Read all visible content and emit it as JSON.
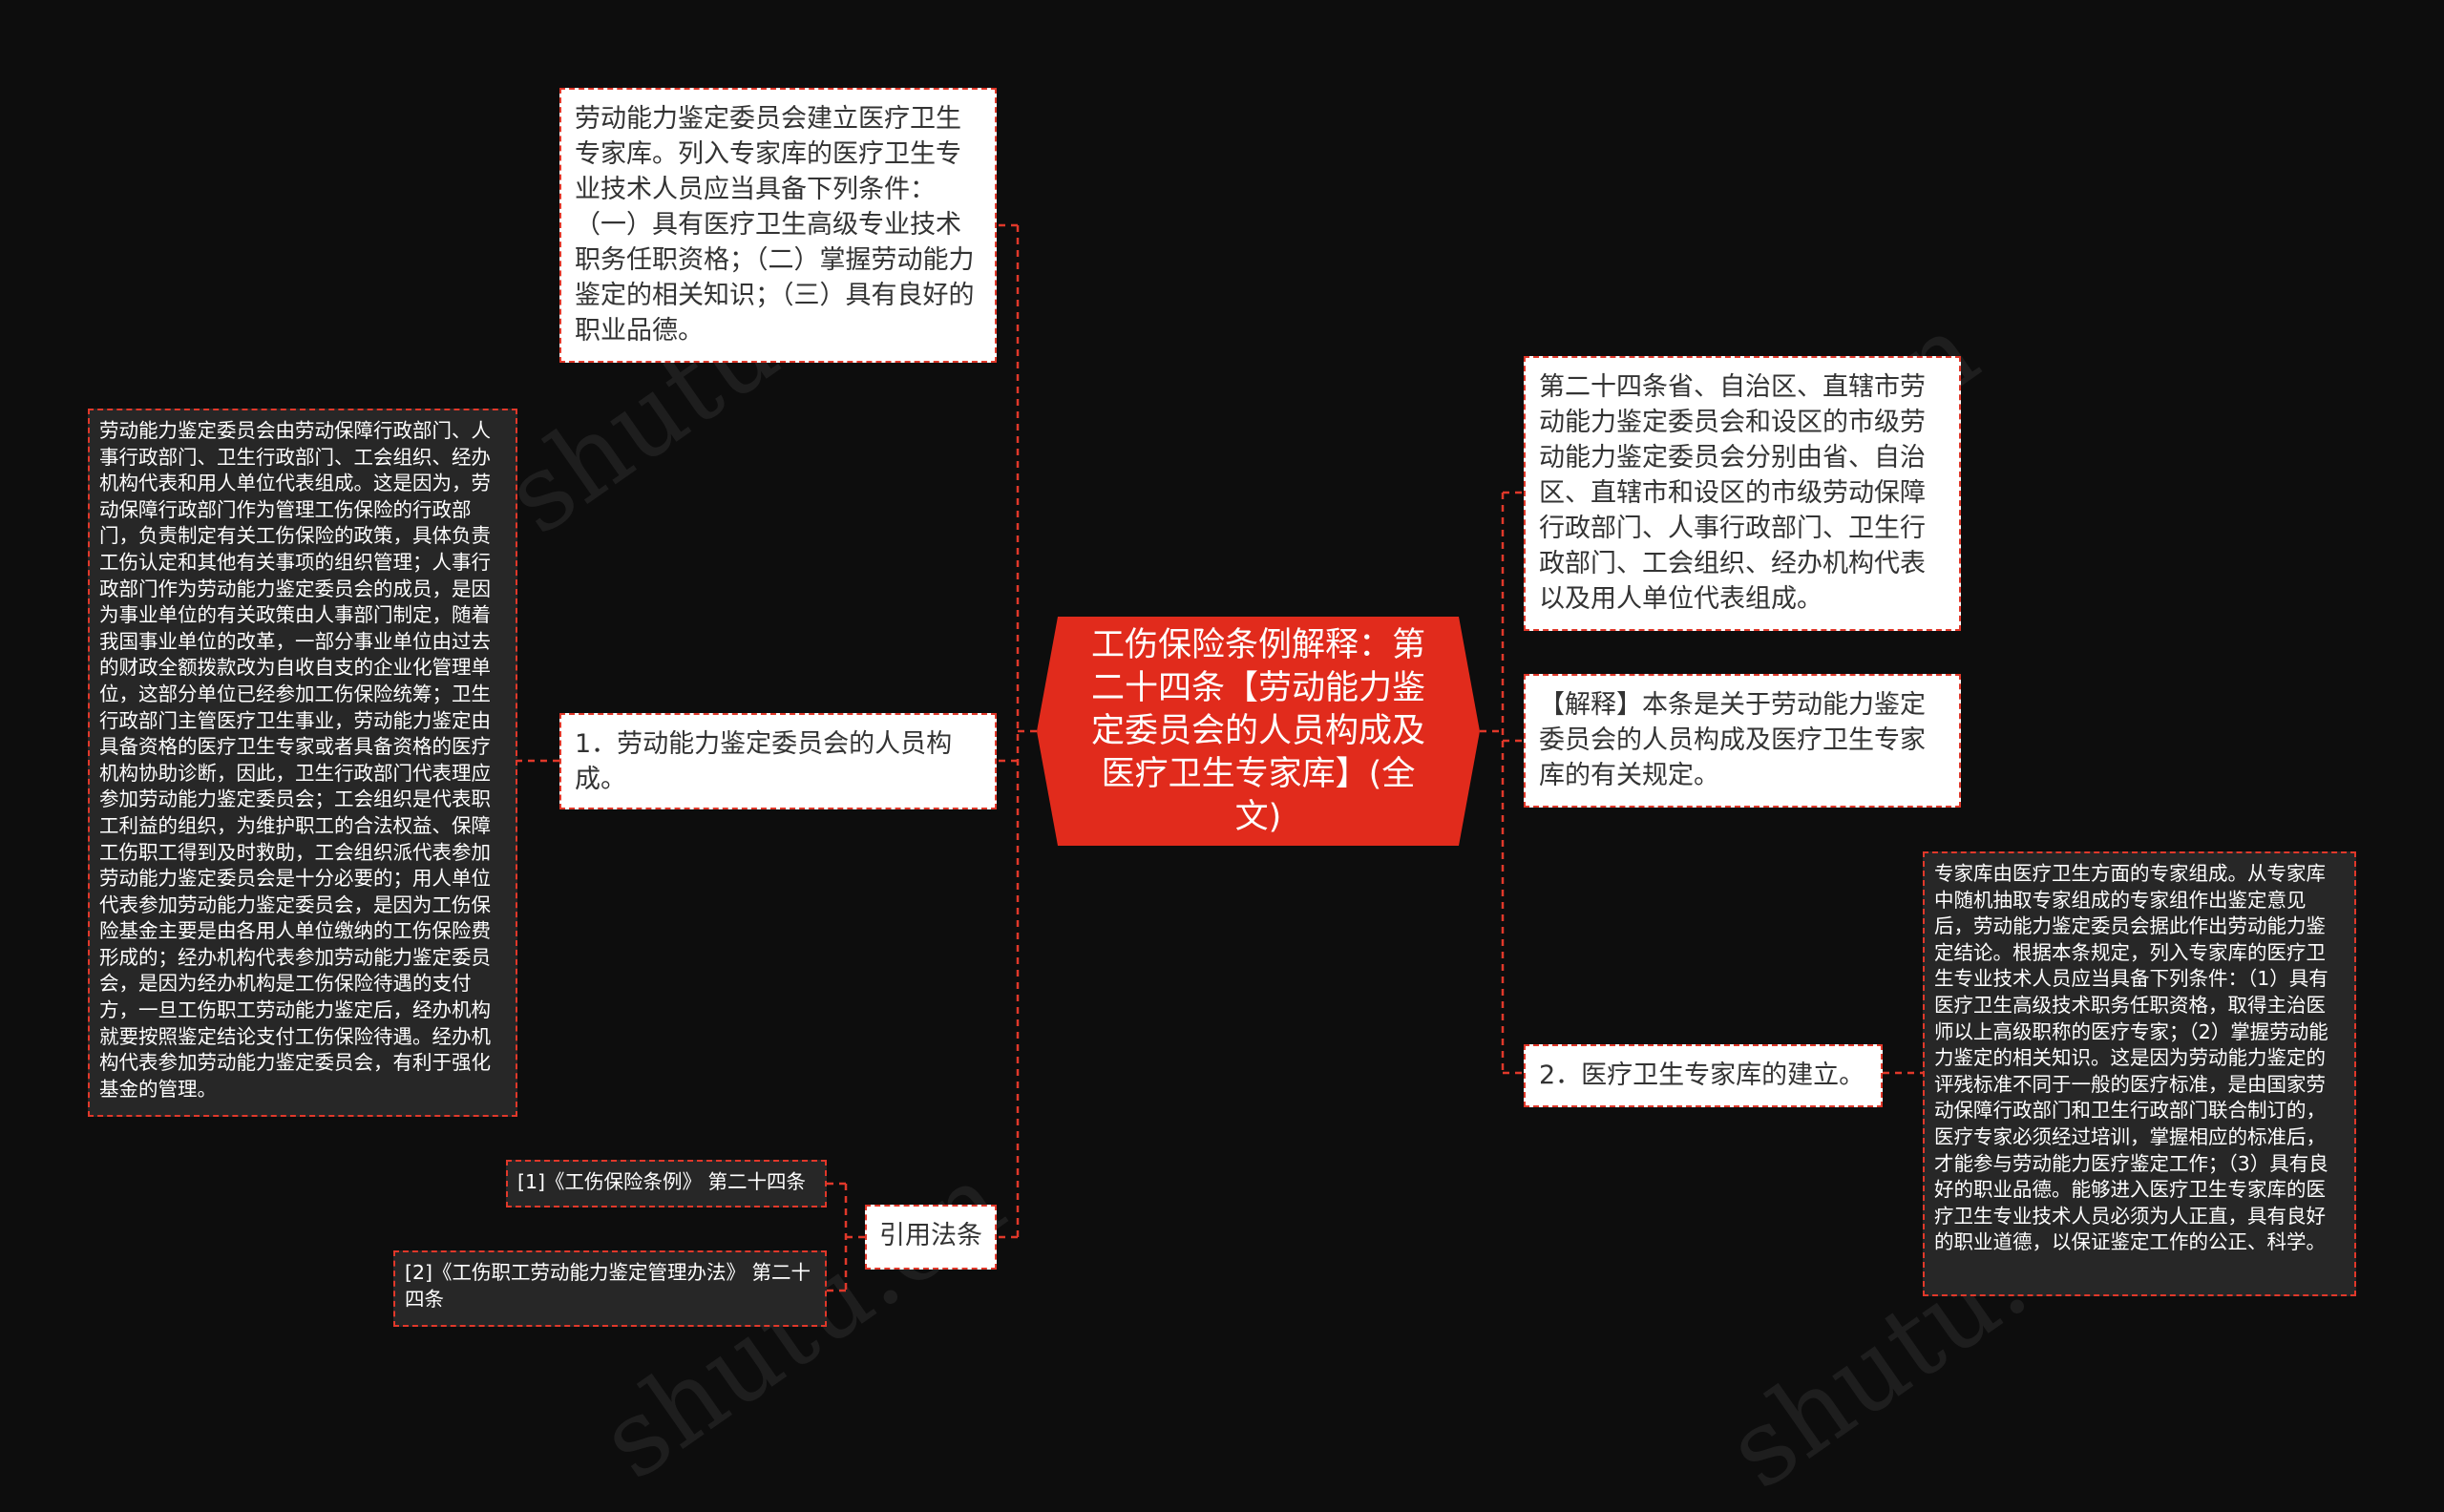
{
  "watermark": "shutu.cn",
  "root": {
    "title": "工伤保险条例解释：第二十四条【劳动能力鉴定委员会的人员构成及医疗卫生专家库】(全文)"
  },
  "left_nodes": {
    "expert_lib": "劳动能力鉴定委员会建立医疗卫生专家库。列入专家库的医疗卫生专业技术人员应当具备下列条件：（一）具有医疗卫生高级专业技术职务任职资格；（二）掌握劳动能力鉴定的相关知识；（三）具有良好的职业品德。",
    "composition": "1．劳动能力鉴定委员会的人员构成。",
    "composition_detail": "劳动能力鉴定委员会由劳动保障行政部门、人事行政部门、卫生行政部门、工会组织、经办机构代表和用人单位代表组成。这是因为，劳动保障行政部门作为管理工伤保险的行政部门，负责制定有关工伤保险的政策，具体负责工伤认定和其他有关事项的组织管理；人事行政部门作为劳动能力鉴定委员会的成员，是因为事业单位的有关政策由人事部门制定，随着我国事业单位的改革，一部分事业单位由过去的财政全额拨款改为自收自支的企业化管理单位，这部分单位已经参加工伤保险统筹；卫生行政部门主管医疗卫生事业，劳动能力鉴定由具备资格的医疗卫生专家或者具备资格的医疗机构协助诊断，因此，卫生行政部门代表理应参加劳动能力鉴定委员会；工会组织是代表职工利益的组织，为维护职工的合法权益、保障工伤职工得到及时救助，工会组织派代表参加劳动能力鉴定委员会是十分必要的；用人单位代表参加劳动能力鉴定委员会，是因为工伤保险基金主要是由各用人单位缴纳的工伤保险费形成的；经办机构代表参加劳动能力鉴定委员会，是因为经办机构是工伤保险待遇的支付方，一旦工伤职工劳动能力鉴定后，经办机构就要按照鉴定结论支付工伤保险待遇。经办机构代表参加劳动能力鉴定委员会，有利于强化基金的管理。",
    "citations": "引用法条",
    "citation_1": "[1]《工伤保险条例》 第二十四条",
    "citation_2": "[2]《工伤职工劳动能力鉴定管理办法》 第二十四条"
  },
  "right_nodes": {
    "article": "第二十四条省、自治区、直辖市劳动能力鉴定委员会和设区的市级劳动能力鉴定委员会分别由省、自治区、直辖市和设区的市级劳动保障行政部门、人事行政部门、卫生行政部门、工会组织、经办机构代表以及用人单位代表组成。",
    "explanation": "【解释】本条是关于劳动能力鉴定委员会的人员构成及医疗卫生专家库的有关规定。",
    "expert_establish": "2．医疗卫生专家库的建立。",
    "expert_detail": "专家库由医疗卫生方面的专家组成。从专家库中随机抽取专家组成的专家组作出鉴定意见后，劳动能力鉴定委员会据此作出劳动能力鉴定结论。根据本条规定，列入专家库的医疗卫生专业技术人员应当具备下列条件：（1）具有医疗卫生高级技术职务任职资格，取得主治医师以上高级职称的医疗专家；（2）掌握劳动能力鉴定的相关知识。这是因为劳动能力鉴定的评残标准不同于一般的医疗标准，是由国家劳动保障行政部门和卫生行政部门联合制订的，医疗专家必须经过培训，掌握相应的标准后，才能参与劳动能力医疗鉴定工作；（3）具有良好的职业品德。能够进入医疗卫生专家库的医疗卫生专业技术人员必须为人正直，具有良好的职业道德，以保证鉴定工作的公正、科学。"
  },
  "colors": {
    "background": "#0d0d0d",
    "accent": "#e12b1c",
    "connector": "#e0382a",
    "dark_node": "#272727",
    "light_node": "#ffffff"
  }
}
